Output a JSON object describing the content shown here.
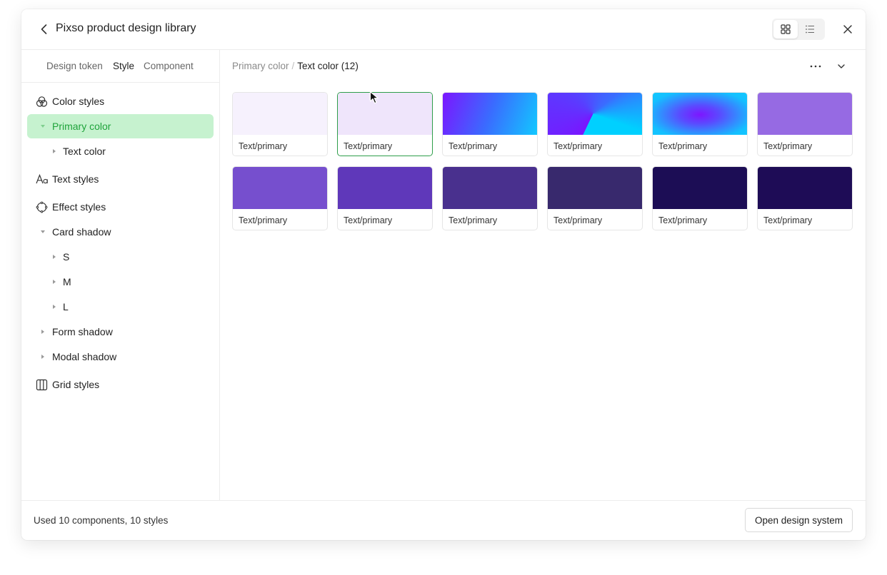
{
  "header": {
    "title": "Pixso product design library",
    "view_modes": [
      "grid-view-icon",
      "list-view-icon"
    ],
    "active_view": "grid"
  },
  "sidebar": {
    "tabs": [
      {
        "label": "Design token",
        "active": false
      },
      {
        "label": "Style",
        "active": true
      },
      {
        "label": "Component",
        "active": false
      }
    ],
    "tree": {
      "color_styles": "Color styles",
      "primary_color": "Primary color",
      "text_color": "Text color",
      "text_styles": "Text styles",
      "effect_styles": "Effect styles",
      "card_shadow": "Card shadow",
      "s": "S",
      "m": "M",
      "l": "L",
      "form_shadow": "Form shadow",
      "modal_shadow": "Modal shadow",
      "grid_styles": "Grid styles"
    },
    "selected_color": "#c6f2cf",
    "selected_text_color": "#1fa33b"
  },
  "main": {
    "breadcrumb_parent": "Primary color",
    "breadcrumb_sep": "/",
    "breadcrumb_current": "Text color (12)",
    "cards": [
      {
        "label": "Text/primary",
        "fill": "#f6f1fd"
      },
      {
        "label": "Text/primary",
        "fill": "#efe5fb",
        "selected": true
      },
      {
        "label": "Text/primary",
        "fill": "linear-gradient(110deg, #7b16ff 0%, #3a6bff 50%, #12c8ff 100%)"
      },
      {
        "label": "Text/primary",
        "fill": "conic-gradient(from 110deg at 48% 50%, #00d0ff 0deg, #00d0ff 95deg, #7a14ff 96deg, #5a3cff 200deg, #3a6cff 300deg, #00d0ff 360deg)"
      },
      {
        "label": "Text/primary",
        "fill": "radial-gradient(ellipse at 50% 52%, #7d16ff 0%, #5a4bff 30%, #14c0ff 80%, #12c8ff 100%)"
      },
      {
        "label": "Text/primary",
        "fill": "#966ae3"
      },
      {
        "label": "Text/primary",
        "fill": "#764fce"
      },
      {
        "label": "Text/primary",
        "fill": "#5f38ba"
      },
      {
        "label": "Text/primary",
        "fill": "#49308e"
      },
      {
        "label": "Text/primary",
        "fill": "#38296d"
      },
      {
        "label": "Text/primary",
        "fill": "#1c0d55"
      },
      {
        "label": "Text/primary",
        "fill": "#1e0c56"
      }
    ]
  },
  "footer": {
    "status": "Used 10 components, 10 styles",
    "open_button": "Open design system"
  },
  "accent": "#2e9e4a"
}
